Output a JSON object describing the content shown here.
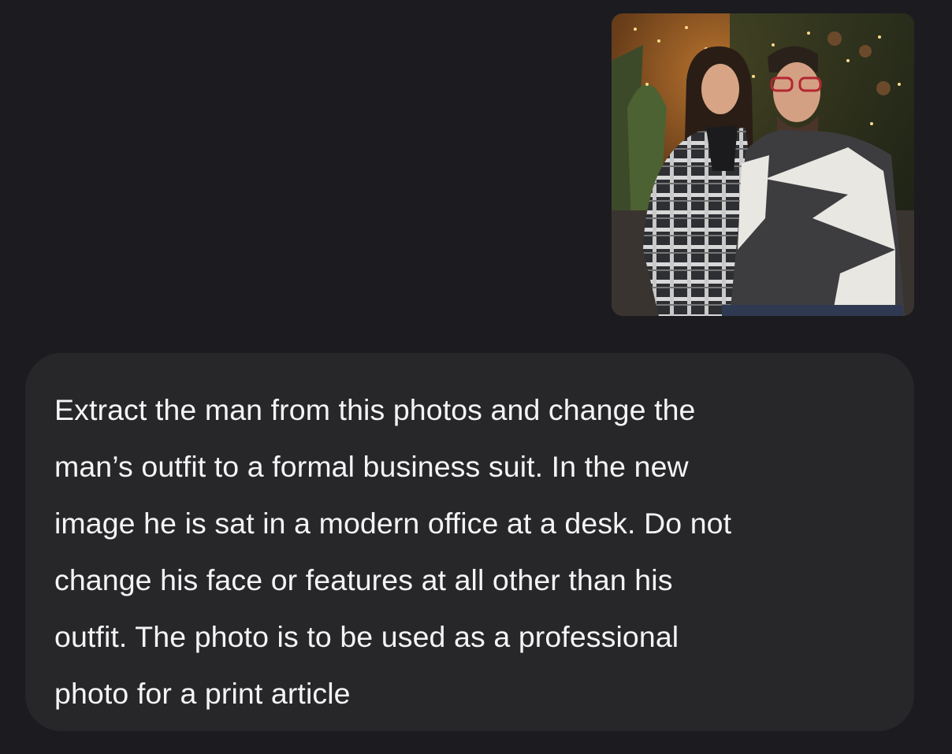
{
  "attachment": {
    "icon": "photo-thumbnail",
    "subject": "couple-holiday-photo"
  },
  "message": {
    "text": "Extract the man from this photos and change the\nman’s outfit to a formal business suit. In the new\nimage he is sat in a modern office at a desk. Do not\nchange his face or features at all other than his\noutfit. The photo is to be used as a professional\nphoto for a print article"
  },
  "colors": {
    "background": "#1c1b20",
    "bubble": "#27272a",
    "text": "#f4f4f5"
  }
}
